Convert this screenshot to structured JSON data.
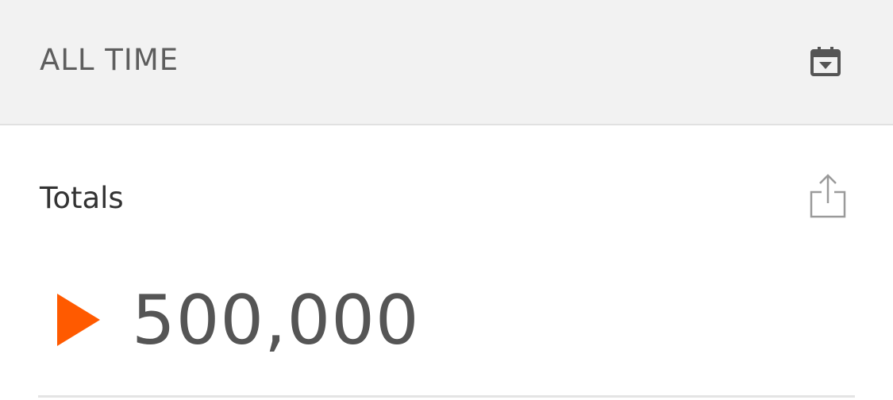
{
  "header": {
    "range_label": "ALL TIME",
    "calendar_icon": "calendar-dropdown-icon"
  },
  "totals": {
    "title": "Totals",
    "share_icon": "share-icon",
    "play_icon": "play-icon",
    "value": "500,000"
  },
  "colors": {
    "header_bg": "#f2f2f2",
    "accent_orange": "#ff5a00",
    "icon_gray": "#555555",
    "share_icon_gray": "#9a9a9a"
  }
}
